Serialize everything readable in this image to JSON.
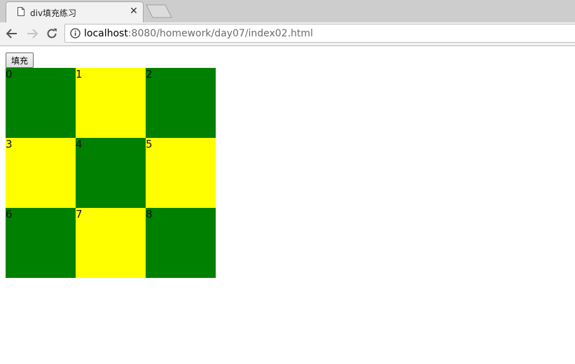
{
  "browser": {
    "tab": {
      "title": "div填充练习",
      "close_glyph": "✕",
      "icon": "page-icon"
    },
    "nav": {
      "back_icon": "back-arrow-icon",
      "forward_icon": "forward-arrow-icon",
      "reload_icon": "reload-icon"
    },
    "address": {
      "host": "localhost",
      "rest": ":8080/homework/day07/index02.html",
      "icon": "info-icon"
    }
  },
  "page": {
    "button_label": "填充",
    "colors": {
      "green": "#008000",
      "yellow": "#ffff00"
    },
    "cells": [
      {
        "label": "0",
        "color": "green"
      },
      {
        "label": "1",
        "color": "yellow"
      },
      {
        "label": "2",
        "color": "green"
      },
      {
        "label": "3",
        "color": "yellow"
      },
      {
        "label": "4",
        "color": "green"
      },
      {
        "label": "5",
        "color": "yellow"
      },
      {
        "label": "6",
        "color": "green"
      },
      {
        "label": "7",
        "color": "yellow"
      },
      {
        "label": "8",
        "color": "green"
      }
    ]
  }
}
